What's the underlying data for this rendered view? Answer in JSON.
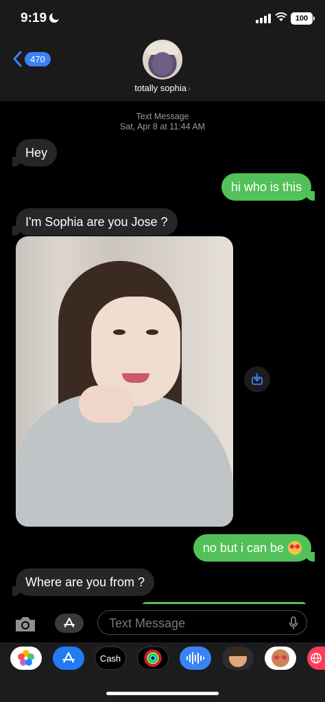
{
  "status_bar": {
    "time": "9:19",
    "battery": "100"
  },
  "nav": {
    "back_count": "470",
    "contact_name": "totally sophia",
    "chevron": "›"
  },
  "thread": {
    "meta_line1": "Text Message",
    "meta_line2": "Sat, Apr 8 at 11:44 AM",
    "messages": [
      {
        "dir": "in",
        "text": "Hey"
      },
      {
        "dir": "out",
        "text": "hi who is this"
      },
      {
        "dir": "in",
        "text": "I'm Sophia are you Jose ?"
      },
      {
        "dir": "in",
        "type": "photo"
      },
      {
        "dir": "out",
        "text": "no but i can be",
        "emoji": "star-struck-emoji"
      },
      {
        "dir": "in",
        "text": "Where are you from ?"
      }
    ]
  },
  "composer": {
    "placeholder": "Text Message"
  },
  "app_tray": {
    "items": [
      "photos-icon",
      "app-store-icon",
      "cash-icon",
      "fitness-icon",
      "voice-memo-icon",
      "memoji-icon",
      "memoji-stickers-icon",
      "browser-icon"
    ],
    "cash_label": "Cash"
  },
  "colors": {
    "incoming": "#262628",
    "outgoing": "#52c15a",
    "accent": "#3b82f6"
  }
}
